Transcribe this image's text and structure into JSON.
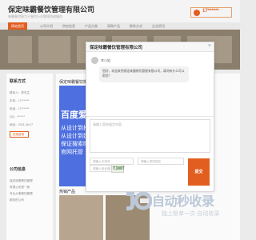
{
  "header": {
    "company": "保定味霸餐饮管理有限公司",
    "subtitle": "味霸餐饮致力于餐饮行业管理咨询服务",
    "hotline": "17******"
  },
  "nav": {
    "items": [
      "网站首页",
      "公司介绍",
      "供应信息",
      "产品分类",
      "采购产品",
      "联系方式",
      "企业资讯"
    ],
    "active_index": 0
  },
  "sidebar": {
    "contact_title": "联系方式",
    "lines": [
      "联系人：李先生",
      "手机：17*******",
      "电话：17*******",
      "QQ：*******",
      "地址：2021-06-07"
    ],
    "online_button": "在线咨询",
    "intro_title": "公司信息",
    "intro_lines": [
      "保定味霸餐饮管理",
      "有限公司是一家",
      "专业从事餐饮管理",
      "服务的公司"
    ]
  },
  "main": {
    "recommend_title": "保定味霸餐饮推荐",
    "ad_title": "百度爱",
    "ad_lines": [
      "从设计到搭",
      "从设计到建站",
      "保证搜索曝光",
      "官网托管"
    ],
    "hot_products_title": "热销产品"
  },
  "modal": {
    "title": "保定味霸餐饮管理有限公司",
    "agent_name": "李小姐",
    "greeting": "您好，欢迎来到保定味霸餐饮管理有限公司，请问有什么可以帮您？",
    "message_placeholder": "请输入您的留言内容",
    "phone_placeholder": "请输入手机号",
    "name_placeholder": "请输入您的姓名",
    "captcha_text": "T3MT",
    "captcha_placeholder": "请输入验证码",
    "submit_label": "提交"
  },
  "watermark": {
    "text": "自动秒收录",
    "slogan": "独上榜单一次·自动收录"
  },
  "colors": {
    "accent": "#e25e20",
    "ad_blue": "#4d6fe0"
  }
}
